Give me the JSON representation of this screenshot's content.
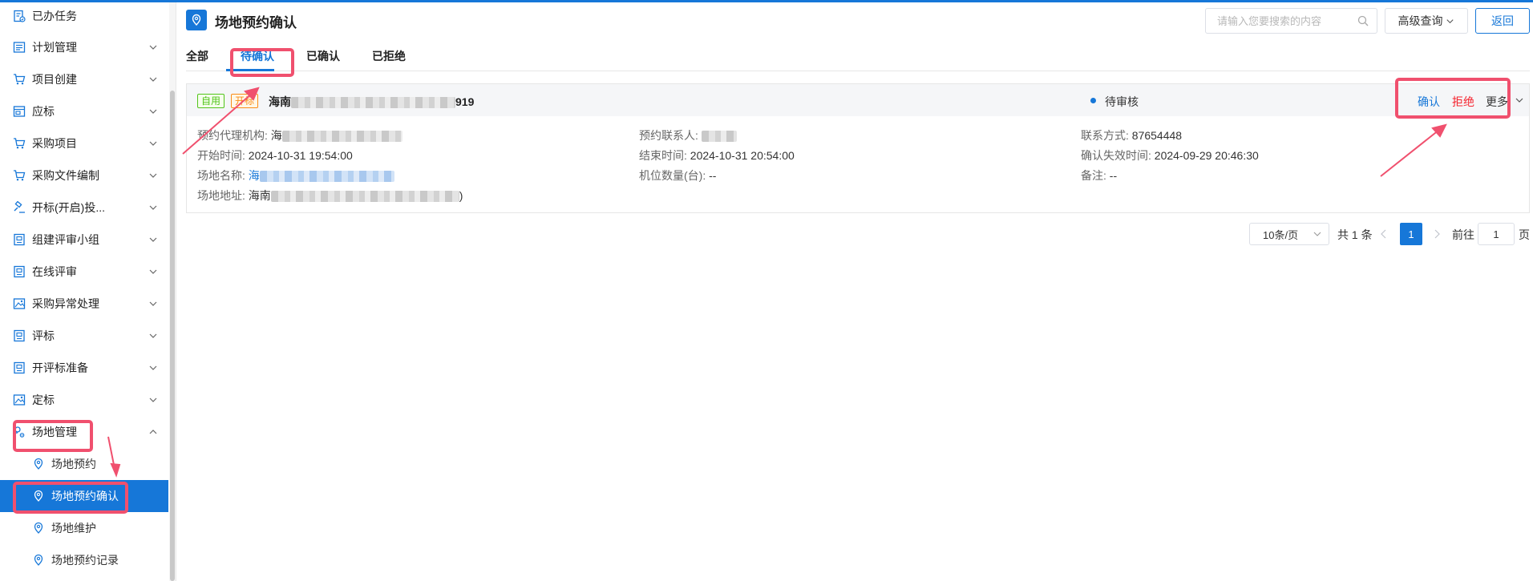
{
  "colors": {
    "accent": "#1677d8",
    "reject": "#f5222d",
    "annotation": "#f0506e"
  },
  "sidebar": {
    "items": [
      {
        "label": "已办任务",
        "icon": "document-icon"
      },
      {
        "label": "计划管理",
        "icon": "list-icon"
      },
      {
        "label": "项目创建",
        "icon": "cart-icon"
      },
      {
        "label": "应标",
        "icon": "window-icon"
      },
      {
        "label": "采购项目",
        "icon": "cart-icon"
      },
      {
        "label": "采购文件编制",
        "icon": "cart-icon"
      },
      {
        "label": "开标(开启)投...",
        "icon": "gavel-icon"
      },
      {
        "label": "组建评审小组",
        "icon": "building-icon"
      },
      {
        "label": "在线评审",
        "icon": "building-icon"
      },
      {
        "label": "采购异常处理",
        "icon": "picture-icon"
      },
      {
        "label": "评标",
        "icon": "building-icon"
      },
      {
        "label": "开评标准备",
        "icon": "building-icon"
      },
      {
        "label": "定标",
        "icon": "picture-icon"
      },
      {
        "label": "场地管理",
        "icon": "person-gear-icon"
      }
    ],
    "sub_items": [
      {
        "label": "场地预约",
        "icon": "map-pin-icon"
      },
      {
        "label": "场地预约确认",
        "icon": "map-pin-icon"
      },
      {
        "label": "场地维护",
        "icon": "map-pin-icon"
      },
      {
        "label": "场地预约记录",
        "icon": "map-pin-icon"
      }
    ]
  },
  "header": {
    "title": "场地预约确认",
    "search_placeholder": "请输入您要搜索的内容",
    "advanced_label": "高级查询",
    "back_label": "返回"
  },
  "tabs": [
    "全部",
    "待确认",
    "已确认",
    "已拒绝"
  ],
  "active_tab": 1,
  "card": {
    "tags": [
      "自用",
      "开标"
    ],
    "title_prefix": "海南",
    "title_suffix": "919",
    "status": "待审核",
    "actions": {
      "confirm": "确认",
      "reject": "拒绝",
      "more": "更多"
    },
    "fields": {
      "agency_label": "预约代理机构:",
      "agency_value": "海",
      "contact_person_label": "预约联系人:",
      "contact_label": "联系方式:",
      "contact_value": "87654448",
      "start_label": "开始时间:",
      "start_value": "2024-10-31 19:54:00",
      "end_label": "结束时间:",
      "end_value": "2024-10-31 20:54:00",
      "deadline_label": "确认失效时间:",
      "deadline_value": "2024-09-29 20:46:30",
      "venue_name_label": "场地名称:",
      "venue_name_value": "海",
      "machines_label": "机位数量(台):",
      "machines_value": "--",
      "remark_label": "备注:",
      "remark_value": "--",
      "address_label": "场地地址:",
      "address_prefix": "海南",
      "address_suffix": ")"
    }
  },
  "pagination": {
    "page_size": "10条/页",
    "total": "共 1 条",
    "current_page": "1",
    "goto_label": "前往",
    "goto_value": "1",
    "page_suffix": "页"
  }
}
